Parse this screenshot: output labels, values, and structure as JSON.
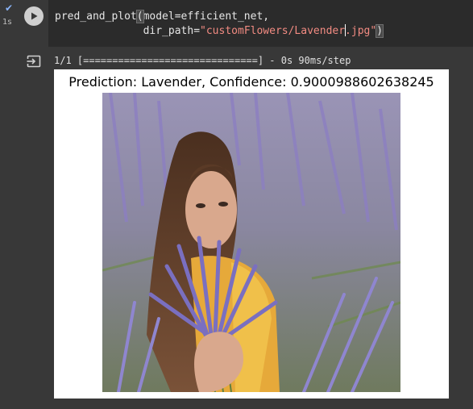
{
  "cell": {
    "status_icon": "checkmark-icon",
    "exec_time": "1s",
    "run_icon": "play-icon",
    "code": {
      "func": "pred_and_plot",
      "open_paren": "(",
      "arg1": "model=efficient_net,",
      "indent": "              ",
      "arg2_key": "dir_path=",
      "arg2_str_a": "\"customFlowers/Lavender",
      "arg2_str_b": ".jpg\"",
      "close_paren": ")"
    }
  },
  "output": {
    "output_icon": "output-redirect-icon",
    "progress_text": "1/1 [==============================] - 0s 90ms/step",
    "progress_fraction": 1.0,
    "figure_title": "Prediction: Lavender, Confidence: 0.9000988602638245",
    "image_description_icon": "lavender-photo"
  },
  "colors": {
    "cell_bg": "#383838",
    "code_bg": "#2b2b2b",
    "string": "#f28b82",
    "check": "#8ab4f8"
  }
}
